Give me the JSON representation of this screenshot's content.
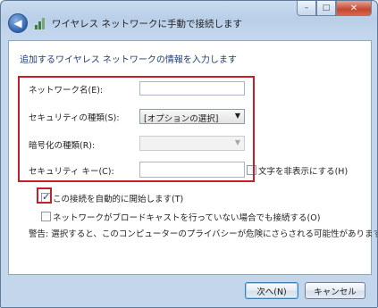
{
  "window": {
    "title": "ワイヤレス ネットワークに手動で接続します",
    "minimize_glyph": "–",
    "maximize_glyph": "□",
    "close_glyph": "✕",
    "back_glyph": "◀"
  },
  "form": {
    "heading": "追加するワイヤレス ネットワークの情報を入力します",
    "network_name_label": "ネットワーク名(E):",
    "network_name_value": "",
    "security_type_label": "セキュリティの種類(S):",
    "security_type_value": "[オプションの選択]",
    "encryption_type_label": "暗号化の種類(R):",
    "encryption_type_value": "",
    "security_key_label": "セキュリティ キー(C):",
    "security_key_value": "",
    "hide_chars_label": "文字を非表示にする(H)",
    "hide_chars_checked": false,
    "auto_connect_label": "この接続を自動的に開始します(T)",
    "auto_connect_checked": true,
    "connect_even_if_not_broadcasting_label": "ネットワークがブロードキャストを行っていない場合でも接続する(O)",
    "connect_even_if_not_broadcasting_checked": false,
    "warning_text": "警告: 選択すると、このコンピューターのプライバシーが危険にさらされる可能性があります。"
  },
  "buttons": {
    "next": "次へ(N)",
    "cancel": "キャンセル"
  },
  "colors": {
    "highlight": "#c41f2a",
    "heading": "#1e3d7b"
  }
}
